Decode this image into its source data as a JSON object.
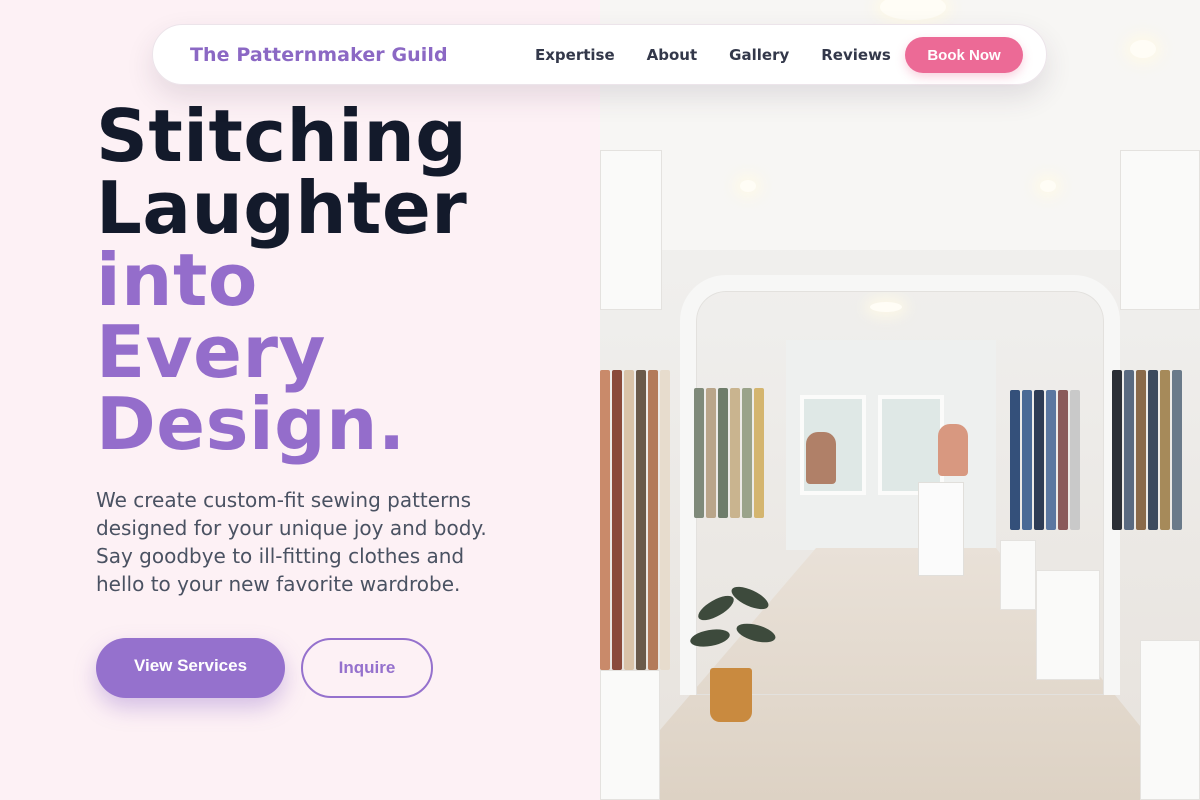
{
  "brand": {
    "name": "The Patternmaker Guild"
  },
  "nav": {
    "links": [
      "Expertise",
      "About",
      "Gallery",
      "Reviews"
    ],
    "cta": "Book Now"
  },
  "hero": {
    "headline_dark": [
      "Stitching",
      "Laughter"
    ],
    "headline_accent": [
      "into",
      "Every",
      "Design."
    ],
    "subtext": "We create custom-fit sewing patterns designed for your unique joy and body. Say goodbye to ill-fitting clothes and hello to your new favorite wardrobe.",
    "primary_button": "View Services",
    "secondary_button": "Inquire"
  },
  "image": {
    "subject": "clothing-boutique-interior-photo"
  },
  "colors": {
    "brand_purple": "#946dcb",
    "cta_pink": "#ec6a96",
    "heading_dark": "#131a2b",
    "background_pink": "#fdf1f5"
  }
}
